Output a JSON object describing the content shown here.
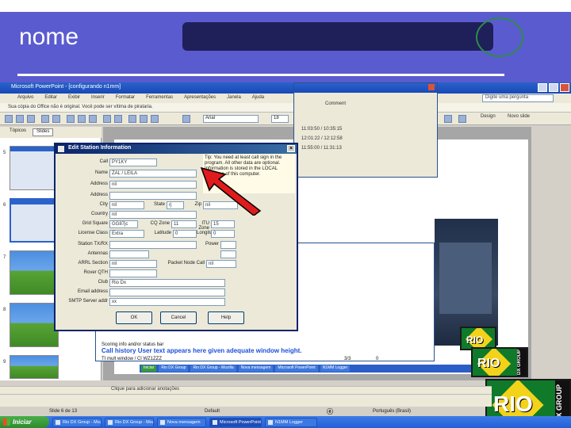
{
  "slide": {
    "title": "nome"
  },
  "powerpoint": {
    "window_title": "Microsoft PowerPoint - [configurando n1mm]",
    "menu": [
      "Arquivo",
      "Editar",
      "Exibir",
      "Inserir",
      "Formatar",
      "Ferramentas",
      "Apresentações",
      "Janela",
      "Ajuda"
    ],
    "help_box": "Digite uma pergunta",
    "notice": "Sua cópia do Office não é original. Você pode ser vítima de pirataria.",
    "font_name": "Arial",
    "font_size": "18",
    "design_button": "Design",
    "new_slide_button": "Novo slide",
    "left_tabs": [
      "Tópicos",
      "Slides"
    ],
    "thumb_numbers": [
      "5",
      "6",
      "7",
      "8",
      "9"
    ],
    "status_slide": "Slide 6 de 13",
    "status_design": "Default",
    "status_lang": "Português (Brasil)",
    "bottom_text": "Clique para adicionar anotações"
  },
  "dialog": {
    "title": "Edit Station Information",
    "close": "×",
    "tip": "Tip: You need at least call sign in the program. All other data are optional. Information is stored in the LOCAL database of this computer.",
    "fields": {
      "call": {
        "label": "Call",
        "value": "PY1KY"
      },
      "name": {
        "label": "Name",
        "value": "ZAL / LEILA"
      },
      "address1": {
        "label": "Address",
        "value": "nil"
      },
      "address2": {
        "label": "Address",
        "value": ""
      },
      "city": {
        "label": "City",
        "value": "nil"
      },
      "state": {
        "label": "State",
        "value": "rj"
      },
      "zip": {
        "label": "Zip",
        "value": "nil"
      },
      "country": {
        "label": "Country",
        "value": "nil"
      },
      "grid_square": {
        "label": "Grid Square",
        "value": "GG87jc"
      },
      "cq_zone": {
        "label": "CQ Zone",
        "value": "11"
      },
      "itu_zone": {
        "label": "ITU Zone",
        "value": "15"
      },
      "license_class": {
        "label": "License Class",
        "value": "Extra"
      },
      "latitude": {
        "label": "Latitude",
        "value": "0"
      },
      "longitude": {
        "label": "Longitude",
        "value": "0"
      },
      "station_tx_rx": {
        "label": "Station TX/RX",
        "value": ""
      },
      "power": {
        "label": "Power",
        "value": ""
      },
      "antennas": {
        "label": "Antennas",
        "value": ""
      },
      "arrl_section": {
        "label": "ARRL Section",
        "value": "nil"
      },
      "packet_node_call": {
        "label": "Packet Node Call",
        "value": "nil"
      },
      "rover_qth": {
        "label": "Rover QTH",
        "value": ""
      },
      "club": {
        "label": "Club",
        "value": "Rio Dx"
      },
      "email": {
        "label": "Email address",
        "value": ""
      },
      "smtp": {
        "label": "SMTP Server addr",
        "value": "xx"
      }
    },
    "buttons": {
      "ok": "OK",
      "cancel": "Cancel",
      "help": "Help"
    }
  },
  "logger": {
    "comment_label": "Comment",
    "rows": [
      "11:03:50 / 10:35:15",
      "12:01:22 / 12:12:58",
      "11:55:00 / 11:31:13"
    ],
    "text1": "Scoring info and/or status bar",
    "call_history_text": "Call history User text appears here given adequate window height.",
    "text3": "TI mult window / Cl WZ1ZZZ",
    "freq": "3/3",
    "freq2": "0"
  },
  "inner_taskbar": [
    "Iniciar",
    "Rio DX Group",
    "Rio DX Group - Mozilla",
    "Nova mensagem",
    "Microsoft PowerPoint",
    "N1MM Logger"
  ],
  "logo": {
    "word": "RIO",
    "side": "DX GROUP"
  },
  "taskbar": {
    "start": "Iniciar",
    "items": [
      "Rio DX Group - Mozilla",
      "Rio DX Group - Mozi...",
      "Nova mensagem",
      "Microsoft PowerPoint...",
      "N1MM Logger"
    ]
  },
  "colors": {
    "title_band": "#5b5bd0",
    "xp_blue": "#245ed8",
    "rio_green": "#0f7a2a",
    "rio_yellow": "#f3d21a",
    "arrow": "#e01b1b"
  }
}
